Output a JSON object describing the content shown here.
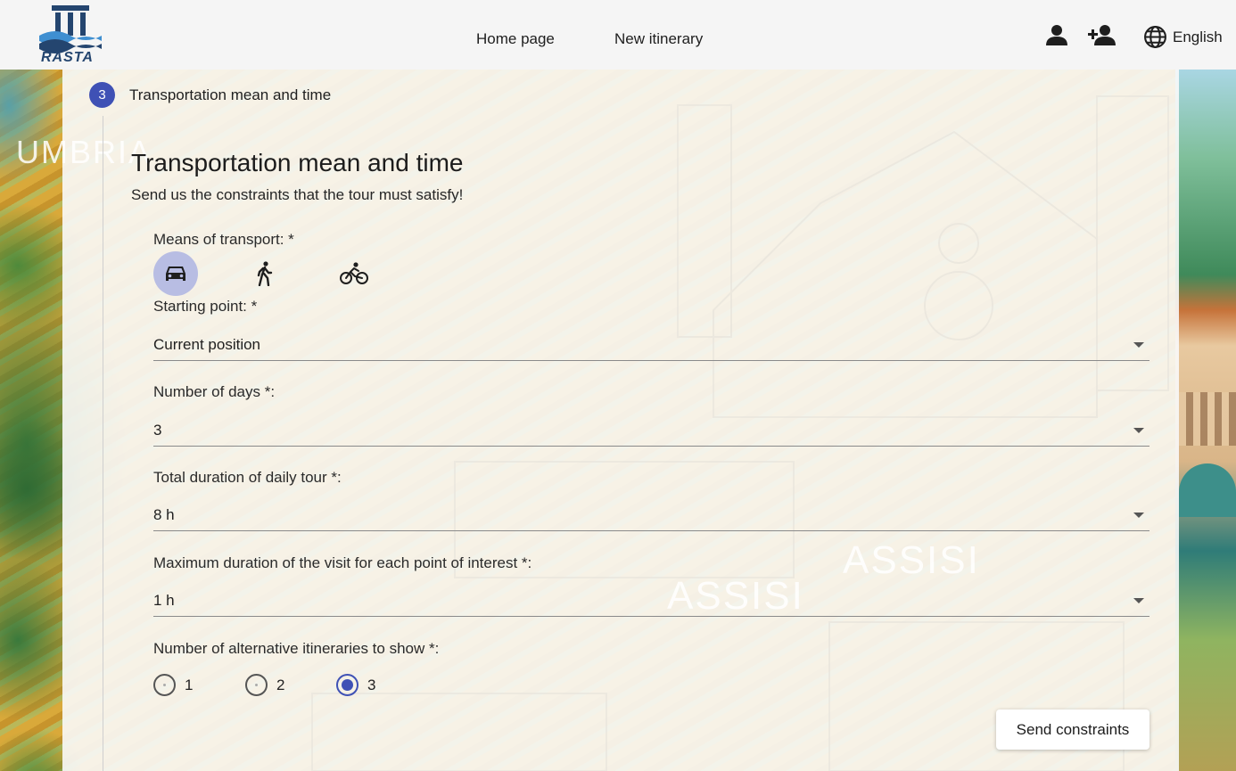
{
  "header": {
    "logo_text": "RASTA",
    "nav": {
      "home": "Home page",
      "new_itinerary": "New itinerary"
    },
    "icons": [
      "user-icon",
      "add-user-icon",
      "globe-icon"
    ],
    "language": "English"
  },
  "background_text": {
    "umbria": "UMBRIA",
    "assisi_1": "ASSISI",
    "assisi_2": "ASSISI"
  },
  "stepper": {
    "number": "3",
    "label": "Transportation mean and time"
  },
  "form": {
    "title": "Transportation mean and time",
    "subtitle": "Send us the constraints that the tour must satisfy!",
    "transport": {
      "label": "Means of transport: *",
      "options": [
        {
          "icon": "car-icon",
          "selected": true
        },
        {
          "icon": "walk-icon",
          "selected": false
        },
        {
          "icon": "bike-icon",
          "selected": false
        }
      ]
    },
    "starting_point": {
      "label": "Starting point: *",
      "value": "Current position"
    },
    "days": {
      "label": "Number of days *:",
      "value": "3"
    },
    "daily_duration": {
      "label": "Total duration of daily tour *:",
      "value": "8 h"
    },
    "visit_duration": {
      "label": "Maximum duration of the visit for each point of interest *:",
      "value": "1 h"
    },
    "alternatives": {
      "label": "Number of alternative itineraries to show *:",
      "options": [
        "1",
        "2",
        "3"
      ],
      "selected": "3"
    },
    "submit": "Send constraints"
  },
  "colors": {
    "accent": "#3f51b5",
    "accent_light": "#b8bde3"
  }
}
